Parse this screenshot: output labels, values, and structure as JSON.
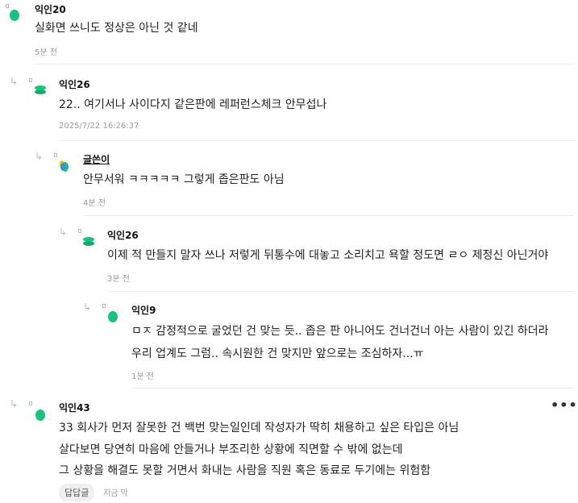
{
  "comments": [
    {
      "name": "익인20",
      "lines": [
        "실화면 쓰니도 정상은 아닌 것 같네"
      ],
      "time": "5분 전"
    },
    {
      "name": "익인26",
      "lines": [
        "22.. 여기서나 사이다지 같은판에 레퍼런스체크 안무섭나"
      ],
      "time": "2025/7/22 16:26:37"
    },
    {
      "name": "글쓴이",
      "lines": [
        "안무서워 ㅋㅋㅋㅋㅋ 그렇게 좁은판도 아님"
      ],
      "time": "4분 전"
    },
    {
      "name": "익인26",
      "lines": [
        "이제 적 만들지 말자 쓰나 저렇게 뒤통수에 대놓고 소리치고 욕할 정도면 ㄹㅇ 제정신 아닌거야"
      ],
      "time": "3분 전"
    },
    {
      "name": "익인9",
      "lines": [
        "ㅁㅈ 감정적으로 굴었던 건 맞는 듯.. 좁은 판 아니어도 건너건너 아는 사람이 있긴 하더라",
        "우리 업계도 그럼.. 속시원한 건 맞지만 앞으로는 조심하자...ㅠ"
      ],
      "time": "1분 전"
    },
    {
      "name": "익인43",
      "lines": [
        "33 회사가 먼저 잘못한 건 백번 맞는일인데 작성자가 딱히 채용하고 싶은 타입은 아님",
        "살다보면 당연히 마음에 안들거나 부조리한 상황에 직면할 수 밖에 없는데",
        "그 상황을 해결도 못할 거면서 화내는 사람을 직원 혹은 동료로 두기에는 위험함"
      ],
      "time": "지금 막",
      "reply_chip": "답답글",
      "more": "•••"
    }
  ],
  "reply_arrow": "↳",
  "colors": {
    "avatar_green": "#19c37d",
    "avatar_blue": "#3a8ee6",
    "avatar_yellow": "#f2c200"
  },
  "icons": [
    "avatar-icon",
    "reply-arrow-icon",
    "more-options-icon"
  ]
}
